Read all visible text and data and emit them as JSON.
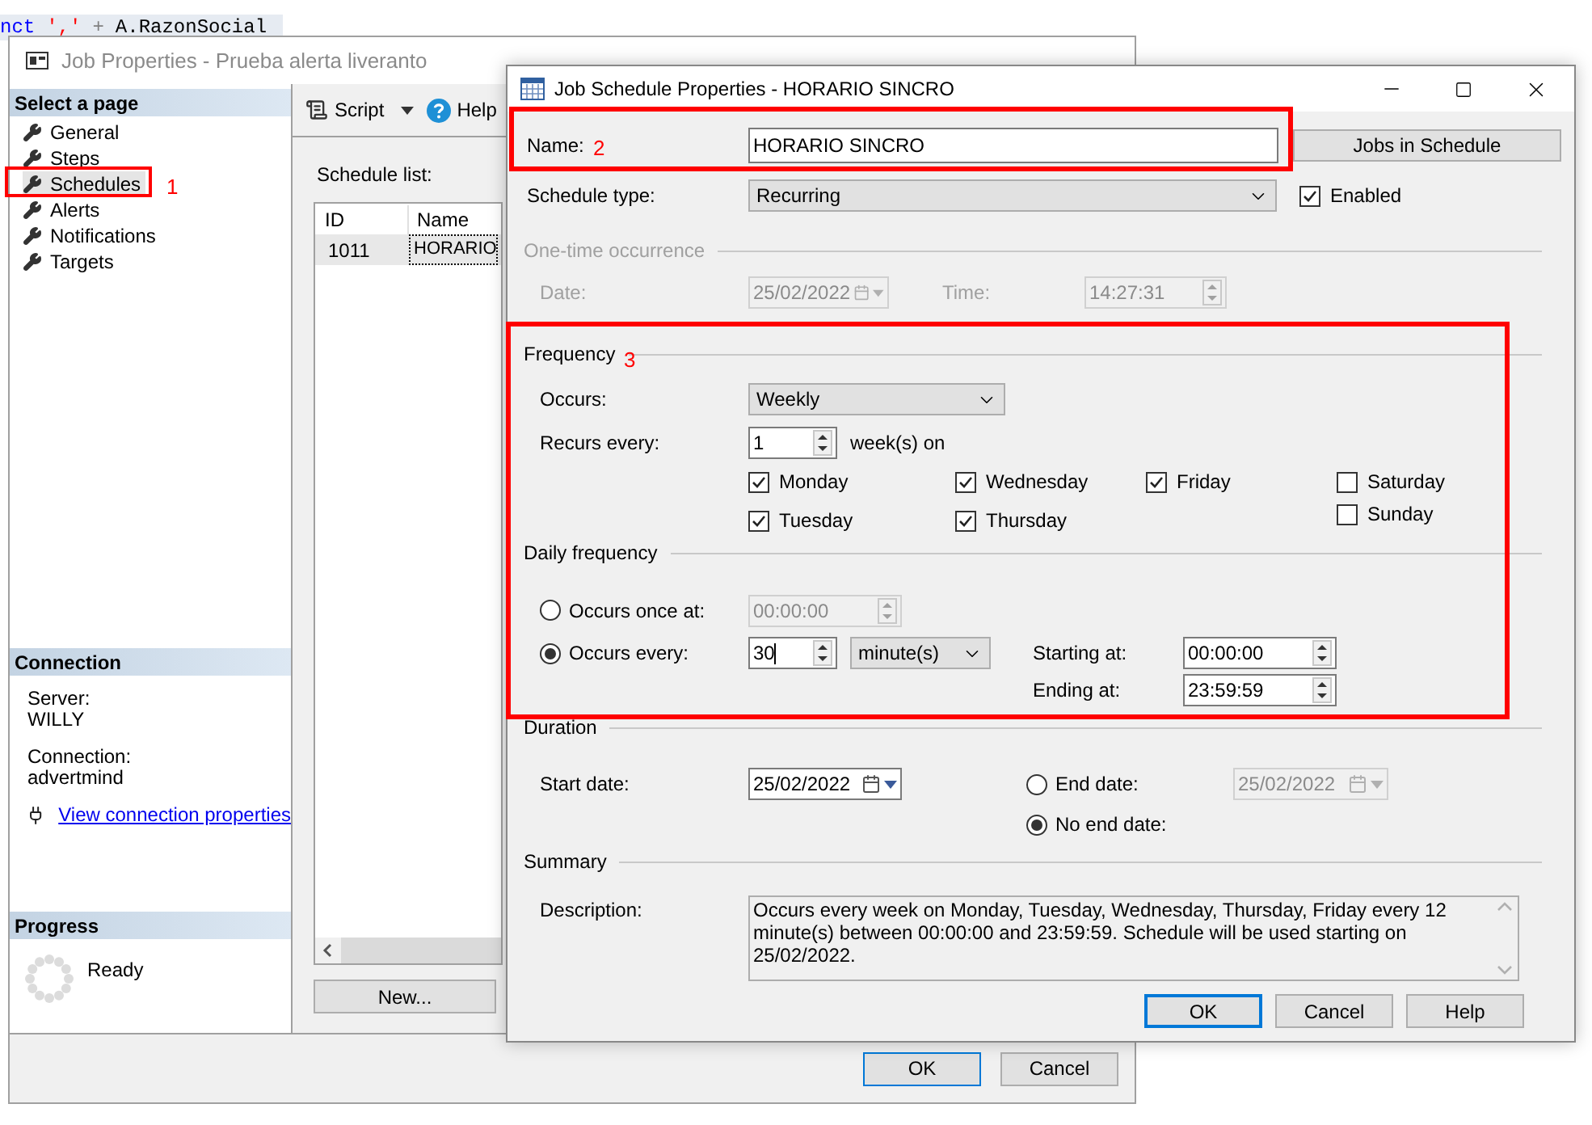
{
  "background_code": [
    {
      "segments": [
        {
          "text": "nct",
          "color": "#0000ff"
        },
        {
          "text": "','",
          "color": "#ff0000"
        },
        {
          "text": "+",
          "color": "#808080"
        },
        {
          "text": "A.RazonSocial",
          "color": "#000000"
        }
      ]
    }
  ],
  "job_window": {
    "title": "Job Properties - Prueba alerta liveranto",
    "select_page_header": "Select a page",
    "pages": [
      {
        "label": "General",
        "selected": false
      },
      {
        "label": "Steps",
        "selected": false
      },
      {
        "label": "Schedules",
        "selected": true
      },
      {
        "label": "Alerts",
        "selected": false
      },
      {
        "label": "Notifications",
        "selected": false
      },
      {
        "label": "Targets",
        "selected": false
      }
    ],
    "connection_header": "Connection",
    "server_label": "Server:",
    "server": "WILLY",
    "connection_label": "Connection:",
    "connection": "advertmind",
    "connection_link": "View connection properties",
    "progress_header": "Progress",
    "progress_status": "Ready",
    "toolbar": {
      "script": "Script",
      "help": "Help"
    },
    "schedule_list_label": "Schedule list:",
    "columns": [
      "ID",
      "Name"
    ],
    "rows": [
      {
        "id": "1011",
        "name": "HORARIO",
        "selected": true
      }
    ],
    "new_button": "New...",
    "ok_button": "OK",
    "cancel_button": "Cancel"
  },
  "schedule_dialog": {
    "title": "Job Schedule Properties - HORARIO SINCRO",
    "name_label": "Name:",
    "name_value": "HORARIO SINCRO",
    "jobs_button": "Jobs in Schedule",
    "schedule_type_label": "Schedule type:",
    "schedule_type": "Recurring",
    "enabled": {
      "label": "Enabled",
      "checked": true
    },
    "one_time": {
      "header": "One-time occurrence",
      "disabled": true,
      "date_label": "Date:",
      "date": "25/02/2022",
      "time_label": "Time:",
      "time": "14:27:31"
    },
    "frequency": {
      "header": "Frequency",
      "occurs_label": "Occurs:",
      "occurs": "Weekly",
      "recurs_label": "Recurs every:",
      "recurs_value": "1",
      "recurs_unit": "week(s) on",
      "day_columns": [
        [
          {
            "label": "Monday",
            "checked": true
          },
          {
            "label": "Tuesday",
            "checked": true
          }
        ],
        [
          {
            "label": "Wednesday",
            "checked": true
          },
          {
            "label": "Thursday",
            "checked": true
          }
        ],
        [
          {
            "label": "Friday",
            "checked": true
          }
        ],
        [
          {
            "label": "Saturday",
            "checked": false
          },
          {
            "label": "Sunday",
            "checked": false
          }
        ]
      ]
    },
    "daily": {
      "header": "Daily frequency",
      "once": {
        "label": "Occurs once at:",
        "selected": false,
        "value": "00:00:00",
        "disabled": true
      },
      "every": {
        "label": "Occurs every:",
        "selected": true,
        "value": "30",
        "unit": "minute(s)"
      },
      "starting_label": "Starting at:",
      "starting": "00:00:00",
      "ending_label": "Ending at:",
      "ending": "23:59:59"
    },
    "duration": {
      "header": "Duration",
      "start_label": "Start date:",
      "start": "25/02/2022",
      "end": {
        "label": "End date:",
        "selected": false,
        "value": "25/02/2022",
        "disabled": true
      },
      "no_end": {
        "label": "No end date:",
        "selected": true
      }
    },
    "summary": {
      "header": "Summary",
      "description_label": "Description:",
      "description": "Occurs every week on Monday, Tuesday, Wednesday, Thursday, Friday every 12 minute(s) between 00:00:00 and 23:59:59. Schedule will be used starting on 25/02/2022."
    },
    "buttons": [
      {
        "label": "OK",
        "default": true
      },
      {
        "label": "Cancel",
        "default": false
      },
      {
        "label": "Help",
        "default": false
      }
    ]
  },
  "annotations": [
    {
      "label": "1"
    },
    {
      "label": "2"
    },
    {
      "label": "3"
    }
  ]
}
